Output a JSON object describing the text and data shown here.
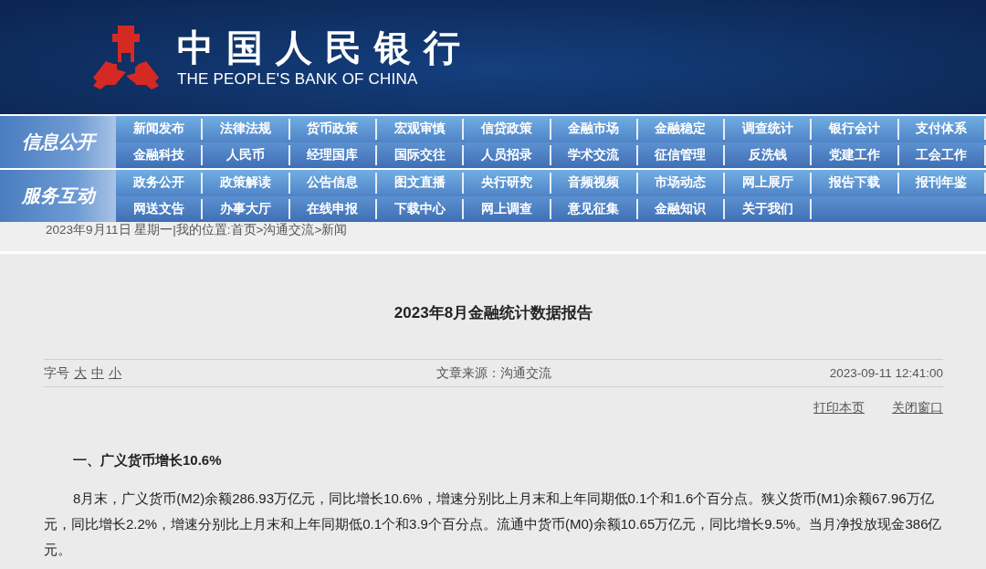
{
  "header": {
    "logo_cn": "中国人民银行",
    "logo_en": "THE PEOPLE'S BANK OF CHINA"
  },
  "nav": [
    {
      "label": "信息公开",
      "rows": [
        [
          "新闻发布",
          "法律法规",
          "货币政策",
          "宏观审慎",
          "信贷政策",
          "金融市场",
          "金融稳定",
          "调查统计",
          "银行会计",
          "支付体系"
        ],
        [
          "金融科技",
          "人民币",
          "经理国库",
          "国际交往",
          "人员招录",
          "学术交流",
          "征信管理",
          "反洗钱",
          "党建工作",
          "工会工作"
        ]
      ]
    },
    {
      "label": "服务互动",
      "rows": [
        [
          "政务公开",
          "政策解读",
          "公告信息",
          "图文直播",
          "央行研究",
          "音频视频",
          "市场动态",
          "网上展厅",
          "报告下载",
          "报刊年鉴"
        ],
        [
          "网送文告",
          "办事大厅",
          "在线申报",
          "下载中心",
          "网上调查",
          "意见征集",
          "金融知识",
          "关于我们"
        ]
      ]
    }
  ],
  "breadcrumb": {
    "date": "2023年9月11日 星期一",
    "separator": "|",
    "location_label": "我的位置:",
    "path": [
      {
        "label": "首页"
      },
      {
        "label": "沟通交流"
      },
      {
        "label": "新闻"
      }
    ],
    "path_separator": ">"
  },
  "article": {
    "title": "2023年8月金融统计数据报告",
    "font_size_label": "字号",
    "font_sizes": [
      "大",
      "中",
      "小"
    ],
    "source": "文章来源：沟通交流",
    "timestamp": "2023-09-11 12:41:00",
    "actions": [
      "打印本页",
      "关闭窗口"
    ],
    "heading": "一、广义货币增长10.6%",
    "paragraph": "8月末，广义货币(M2)余额286.93万亿元，同比增长10.6%，增速分别比上月末和上年同期低0.1个和1.6个百分点。狭义货币(M1)余额67.96万亿元，同比增长2.2%，增速分别比上月末和上年同期低0.1个和3.9个百分点。流通中货币(M0)余额10.65万亿元，同比增长9.5%。当月净投放现金386亿元。"
  }
}
